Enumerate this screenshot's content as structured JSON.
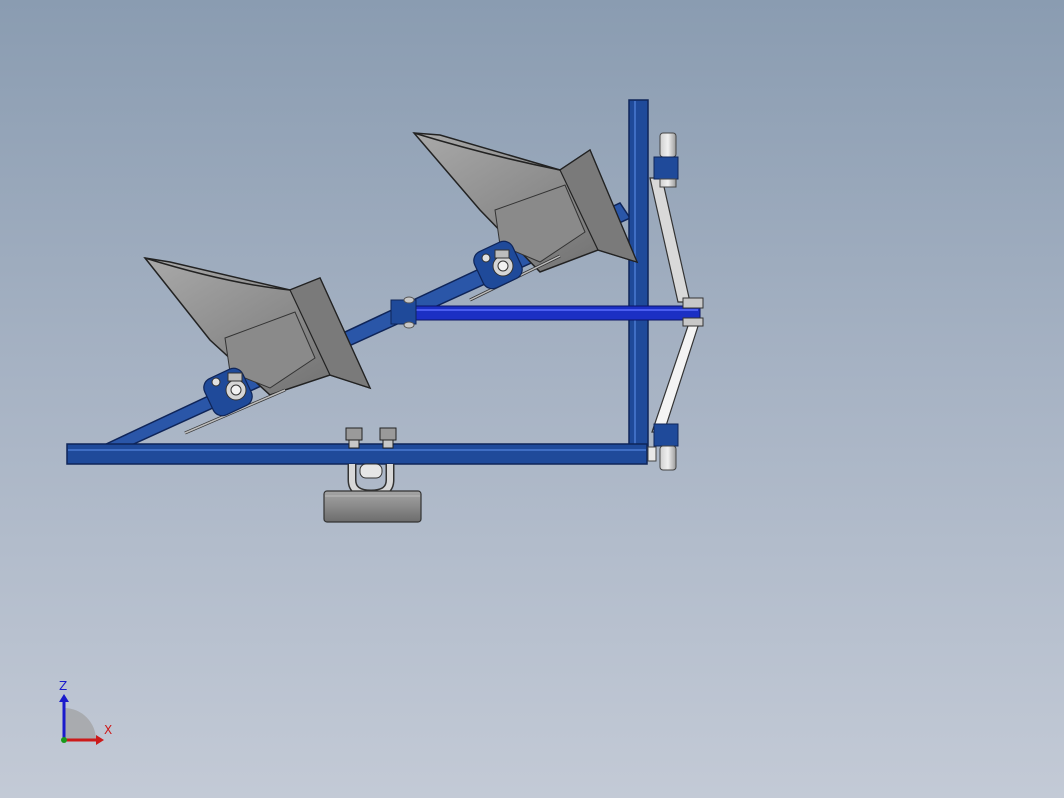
{
  "viewport": {
    "background_top": "#8a9cb1",
    "background_bottom": "#c3cad6"
  },
  "model": {
    "frame_color": "#1f4a9a",
    "frame_edge_color": "#0f2559",
    "rod_color": "#1b2fc4",
    "plow_color": "#8c8c8c",
    "plow_dark_color": "#6f6f6f",
    "weight_color": "#8e8e8e"
  },
  "triad": {
    "z_label": "Z",
    "x_label": "X",
    "z_color": "#1a1acc",
    "x_color": "#cc1a1a",
    "y_color": "#1a9a1a"
  }
}
